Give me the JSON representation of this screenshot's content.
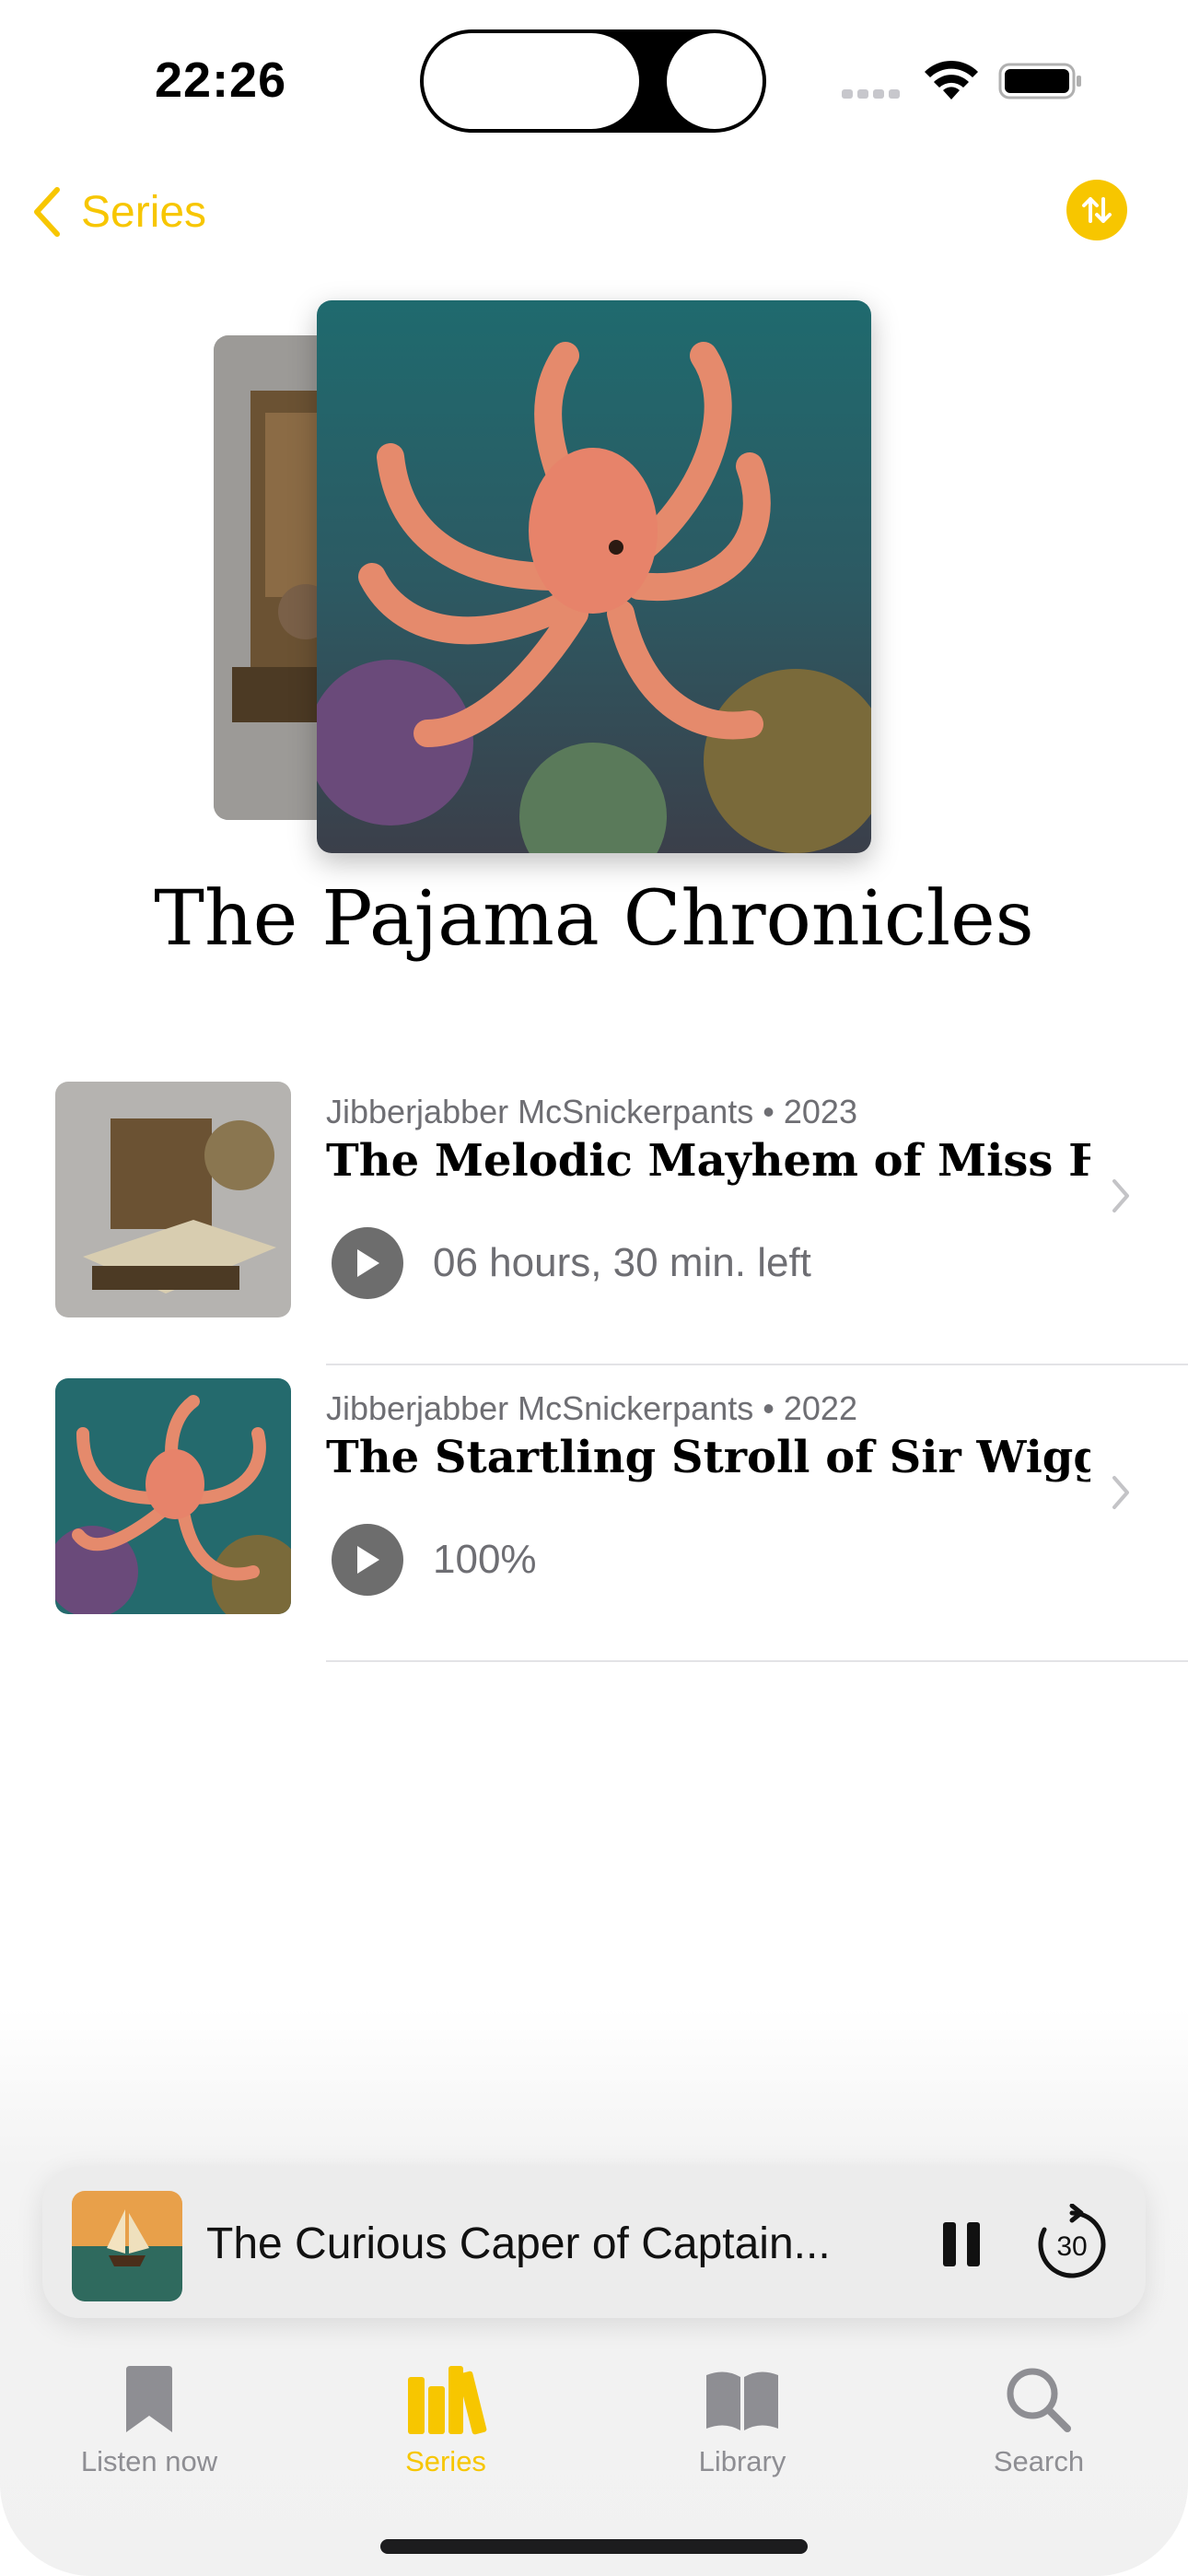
{
  "status_bar": {
    "time": "22:26"
  },
  "nav": {
    "back_label": "Series"
  },
  "series": {
    "title": "The Pajama Chronicles"
  },
  "books": [
    {
      "author": "Jibberjabber McSnickerpants",
      "year": "2023",
      "title": "The Melodic Mayhem of Miss Fl...",
      "progress": "06 hours, 30 min. left"
    },
    {
      "author": "Jibberjabber McSnickerpants",
      "year": "2022",
      "title": "The Startling Stroll of Sir Wiggl...",
      "progress": "100%"
    }
  ],
  "mini_player": {
    "title": "The Curious Caper of Captain...",
    "skip_seconds": "30"
  },
  "tabs": [
    {
      "label": "Listen now",
      "icon": "bookmark-icon",
      "active": false
    },
    {
      "label": "Series",
      "icon": "books-icon",
      "active": true
    },
    {
      "label": "Library",
      "icon": "book-icon",
      "active": false
    },
    {
      "label": "Search",
      "icon": "search-icon",
      "active": false
    }
  ],
  "colors": {
    "accent": "#f7c600",
    "secondary_text": "#6e6e73"
  },
  "meta_separator": "•"
}
